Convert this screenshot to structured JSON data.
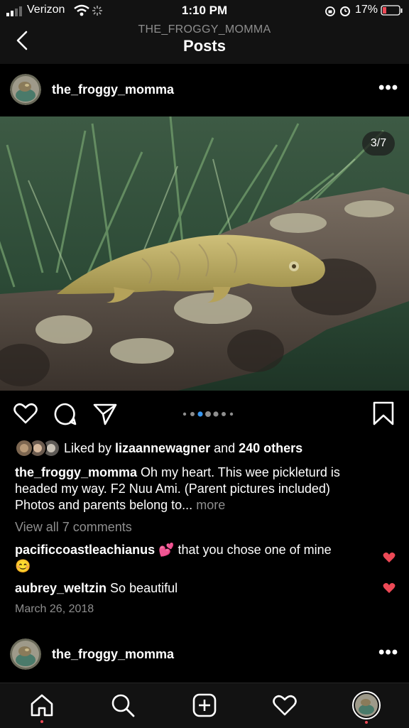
{
  "status_bar": {
    "carrier": "Verizon",
    "time": "1:10 PM",
    "battery": "17%"
  },
  "header": {
    "subtitle": "THE_FROGGY_MOMMA",
    "title": "Posts"
  },
  "post": {
    "username": "the_froggy_momma",
    "image_counter": "3/7",
    "carousel_total": 7,
    "carousel_active": 3,
    "liked_by_prefix": "Liked by ",
    "liked_by_user": "lizaannewagner",
    "liked_by_and": " and ",
    "liked_by_others": "240 others",
    "caption_user": "the_froggy_momma",
    "caption_line1": " Oh my heart. This wee pickleturd is",
    "caption_line2": "headed my way. F2 Nuu Ami. (Parent pictures included)",
    "caption_line3": "Photos and parents belong to...",
    "caption_more": "more",
    "view_comments": "View all 7 comments",
    "comments": [
      {
        "user": "pacificcoastleachianus",
        "emoji1": "💕",
        "text": " that you chose one of mine",
        "emoji2": "😊"
      },
      {
        "user": "aubrey_weltzin",
        "text": " So beautiful"
      }
    ],
    "date": "March 26, 2018"
  },
  "next_post": {
    "username": "the_froggy_momma"
  },
  "colors": {
    "like_red": "#ed4956",
    "active_dot": "#3897f0",
    "muted": "#8e8e8e"
  },
  "icons": [
    "back-chevron-icon",
    "more-icon",
    "heart-icon",
    "comment-icon",
    "share-icon",
    "bookmark-icon",
    "home-icon",
    "search-icon",
    "new-post-icon",
    "activity-heart-icon",
    "profile-avatar-icon"
  ]
}
